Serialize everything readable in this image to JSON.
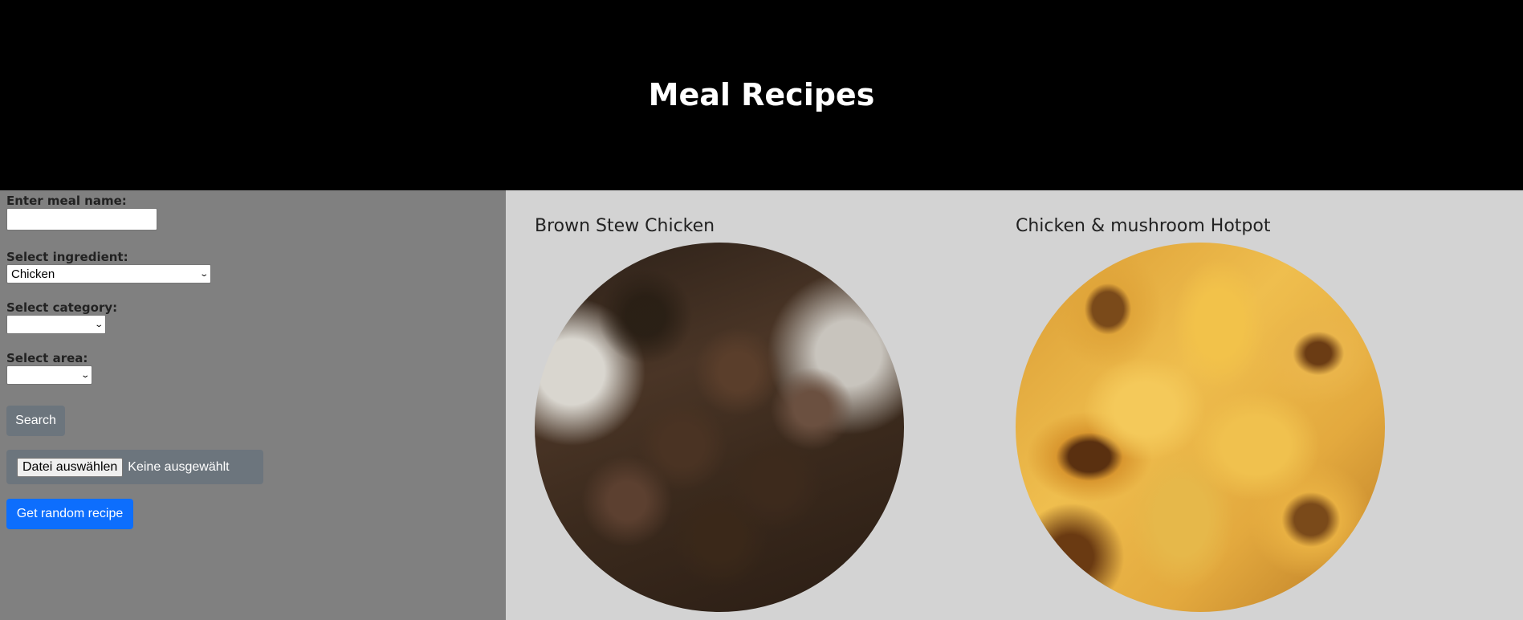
{
  "header": {
    "title": "Meal Recipes"
  },
  "sidebar": {
    "meal_name_label": "Enter meal name:",
    "meal_name_value": "",
    "ingredient_label": "Select ingredient:",
    "ingredient_value": "Chicken",
    "category_label": "Select category:",
    "category_value": "",
    "area_label": "Select area:",
    "area_value": "",
    "search_button": "Search",
    "file_button": "Datei auswählen",
    "file_status": "Keine ausgewählt",
    "random_button": "Get random recipe"
  },
  "meals": [
    {
      "title": "Brown Stew Chicken",
      "image": "brown-stew-chicken-photo"
    },
    {
      "title": "Chicken & mushroom Hotpot",
      "image": "chicken-mushroom-hotpot-photo"
    }
  ],
  "colors": {
    "header_bg": "#000000",
    "sidebar_bg": "#808080",
    "content_bg": "#d3d3d3",
    "secondary_button": "#6c757d",
    "primary_button": "#0d6efd"
  }
}
